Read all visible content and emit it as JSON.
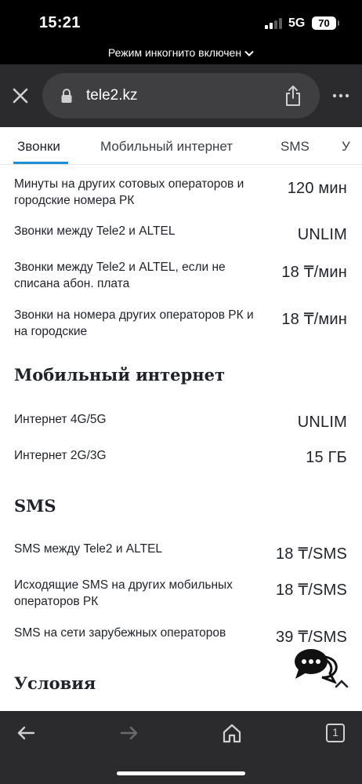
{
  "status_bar": {
    "time": "15:21",
    "network": "5G",
    "battery": "70"
  },
  "incognito_banner": "Режим инкогнито включен",
  "browser": {
    "url": "tele2.kz"
  },
  "tabs": [
    {
      "label": "Звонки",
      "active": true
    },
    {
      "label": "Мобильный интернет",
      "active": false
    },
    {
      "label": "SMS",
      "active": false
    },
    {
      "label": "У",
      "active": false
    }
  ],
  "calls": [
    {
      "label": "Минуты на других сотовых операторов и городские номера РК",
      "value": "120 мин"
    },
    {
      "label": "Звонки между Tele2 и ALTEL",
      "value": "UNLIM"
    },
    {
      "label": "Звонки между Tele2 и ALTEL, если не списана абон. плата",
      "value": "18 ₸/мин"
    },
    {
      "label": "Звонки на номера других операторов РК и на городские",
      "value": "18 ₸/мин"
    }
  ],
  "internet": {
    "title": "Мобильный интернет",
    "items": [
      {
        "label": "Интернет 4G/5G",
        "value": "UNLIM"
      },
      {
        "label": "Интернет 2G/3G",
        "value": "15 ГБ"
      }
    ]
  },
  "sms": {
    "title": "SMS",
    "items": [
      {
        "label": "SMS между Tele2 и ALTEL",
        "value": "18 ₸/SMS"
      },
      {
        "label": "Исходящие SMS на других мобильных операторов РК",
        "value": "18 ₸/SMS"
      },
      {
        "label": "SMS на сети зарубежных операторов",
        "value": "39 ₸/SMS"
      }
    ]
  },
  "conditions": {
    "title": "Условия"
  },
  "bottom_bar": {
    "tab_count": "1"
  }
}
